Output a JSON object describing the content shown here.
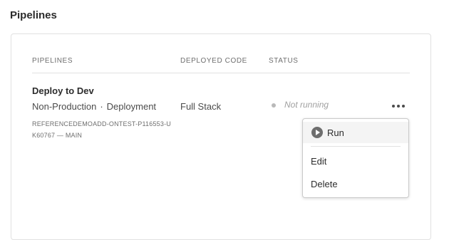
{
  "section": {
    "title": "Pipelines"
  },
  "table": {
    "headers": {
      "pipelines": "PIPELINES",
      "deployed_code": "DEPLOYED CODE",
      "status": "STATUS"
    },
    "rows": [
      {
        "name": "Deploy to Dev",
        "environment": "Non-Production",
        "separator": "·",
        "type": "Deployment",
        "branch": "REFERENCEDEMOADD-ONTEST-P116553-UK60767 — MAIN",
        "deployed_code": "Full Stack",
        "status": "Not running"
      }
    ]
  },
  "menu": {
    "run_label": "Run",
    "edit_label": "Edit",
    "delete_label": "Delete"
  },
  "icons": {
    "more": "more-horizontal-icon",
    "run": "play-circle-icon",
    "status": "status-dot-icon"
  },
  "colors": {
    "status_dot": "#b9b9b9",
    "status_text": "#a0a0a0",
    "menu_highlight": "#f4f4f4"
  }
}
